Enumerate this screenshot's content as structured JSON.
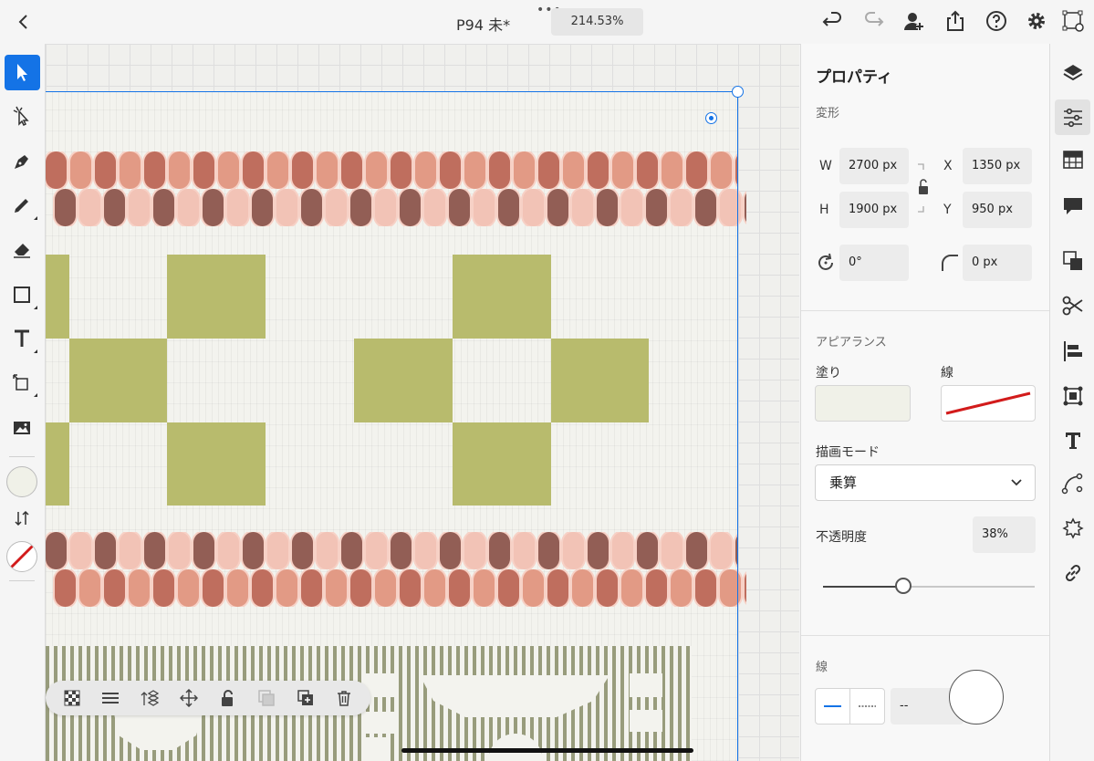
{
  "document": {
    "title": "P94 未*",
    "zoom": "214.53%"
  },
  "colors": {
    "accent": "#1473e6",
    "fill": "#f0f1e8",
    "olive": "#b8bb6d",
    "stroke_red": "#d21b1b"
  },
  "toolbar_icons": [
    "back-icon",
    "undo-icon",
    "redo-icon",
    "invite-user-icon",
    "share-icon",
    "help-icon",
    "settings-icon",
    "preview-icon"
  ],
  "left_tools": [
    "selection-tool",
    "direct-selection-tool",
    "pen-tool",
    "pencil-tool",
    "eraser-tool",
    "rectangle-tool",
    "type-tool",
    "transform-tool",
    "image-tool",
    "fill-swatch",
    "swap-icon",
    "stroke-swatch"
  ],
  "properties": {
    "title": "プロパティ",
    "transform": {
      "section": "変形",
      "w_label": "W",
      "w_value": "2700 px",
      "h_label": "H",
      "h_value": "1900 px",
      "x_label": "X",
      "x_value": "1350 px",
      "y_label": "Y",
      "y_value": "950 px",
      "rotation": "0°",
      "corner": "0 px"
    },
    "appearance": {
      "section": "アピアランス",
      "fill_label": "塗り",
      "stroke_label": "線",
      "blend_label": "描画モード",
      "blend_value": "乗算",
      "opacity_label": "不透明度",
      "opacity_value": "38%",
      "opacity_fraction": 0.38
    },
    "stroke": {
      "section": "線",
      "dash_value": "--"
    }
  },
  "right_panel_icons": [
    "layers-icon",
    "properties-icon",
    "swatches-icon",
    "comments-icon",
    "pathfinder-icon",
    "scissors-icon",
    "align-icon",
    "frame-icon",
    "type-panel-icon",
    "path-icon",
    "symbols-icon",
    "link-icon"
  ],
  "float_toolbar_icons": [
    "transparency-icon",
    "align-menu-icon",
    "arrange-icon",
    "move-icon",
    "lock-icon",
    "group-icon",
    "duplicate-icon",
    "delete-icon"
  ]
}
